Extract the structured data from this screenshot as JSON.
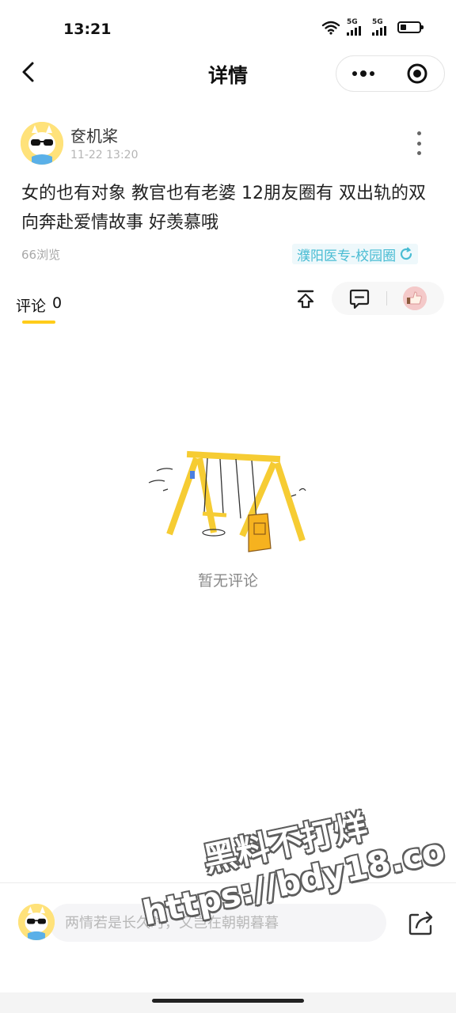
{
  "status_bar": {
    "time": "13:21",
    "signal1_label": "5G",
    "signal2_label": "5G",
    "battery_level": 0.3,
    "icons": [
      "wifi-icon",
      "signal-icon",
      "signal-icon",
      "battery-icon"
    ]
  },
  "header": {
    "title": "详情",
    "icons": [
      "back-icon",
      "more-dots-icon",
      "close-target-icon"
    ]
  },
  "post": {
    "author": "奁机桨",
    "time": "11-22 13:20",
    "content": "女的也有对象 教官也有老婆 12朋友圈有 双出轨的双向奔赴爱情故事 好羡慕哦",
    "views": "66浏览",
    "circle_tag": "濮阳医专-校园圈"
  },
  "comments": {
    "tab_label": "评论",
    "count": "0",
    "empty_text": "暂无评论"
  },
  "bottom_bar": {
    "input_placeholder": "两情若是长久时，又岂在朝朝暮暮"
  },
  "watermark": {
    "line1": "黑料不打烊",
    "line2": "https://bdy18.co"
  },
  "colors": {
    "accent_yellow": "#ffcc1a",
    "tag_blue": "#49bcd3",
    "tag_bg": "#eef8fb"
  }
}
